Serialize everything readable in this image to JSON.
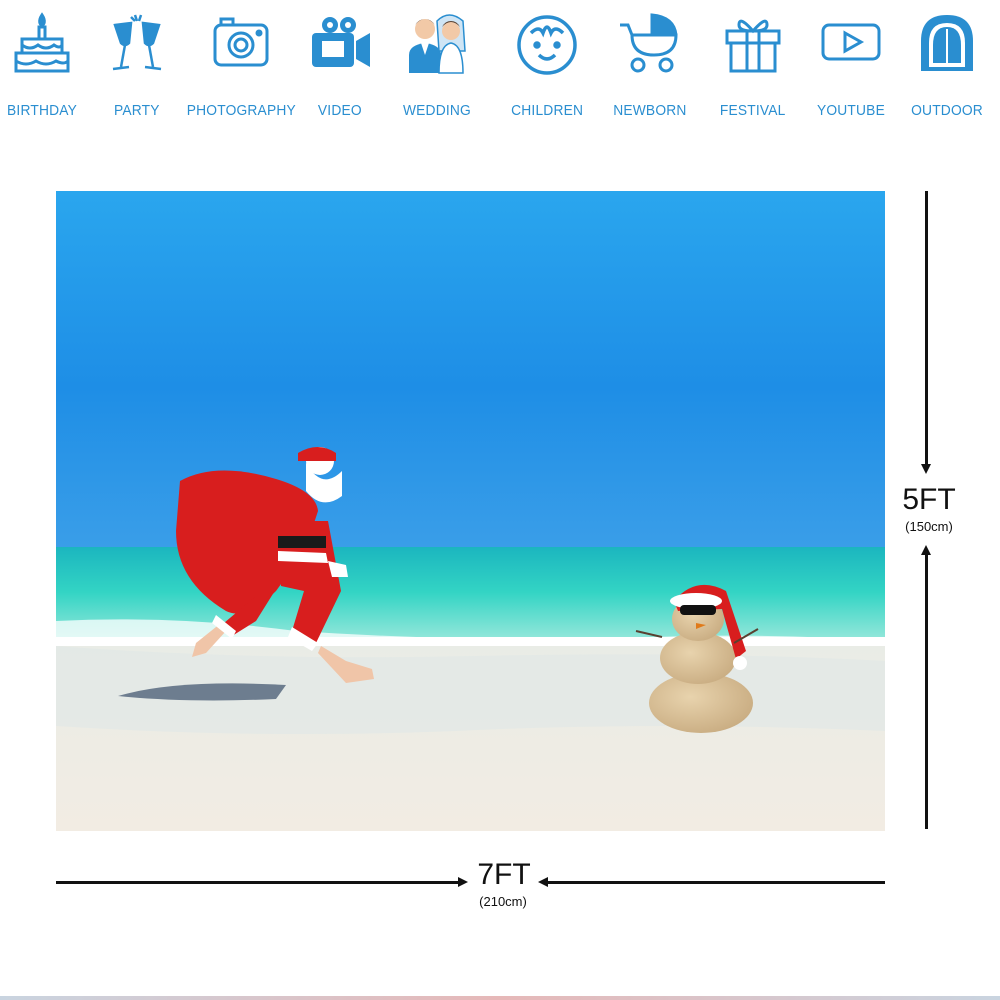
{
  "categories": [
    {
      "label": "BIRTHDAY",
      "icon": "birthday-cake-icon"
    },
    {
      "label": "PARTY",
      "icon": "champagne-glasses-icon"
    },
    {
      "label": "PHOTOGRAPHY",
      "icon": "camera-icon"
    },
    {
      "label": "VIDEO",
      "icon": "video-camera-icon"
    },
    {
      "label": "WEDDING",
      "icon": "bride-groom-icon"
    },
    {
      "label": "CHILDREN",
      "icon": "child-face-icon"
    },
    {
      "label": "NEWBORN",
      "icon": "baby-stroller-icon"
    },
    {
      "label": "FESTIVAL",
      "icon": "gift-box-icon"
    },
    {
      "label": "YOUTUBE",
      "icon": "play-button-icon"
    },
    {
      "label": "OUTDOOR",
      "icon": "tent-icon"
    }
  ],
  "dimensions": {
    "height_label": "5FT",
    "height_sub": "(150cm)",
    "width_label": "7FT",
    "width_sub": "(210cm)"
  },
  "colors": {
    "icon_blue": "#2a8ed0",
    "sky_top": "#1e9be8",
    "sea": "#2fd3c6",
    "sand": "#efeae2",
    "santa_red": "#d81e1e"
  }
}
